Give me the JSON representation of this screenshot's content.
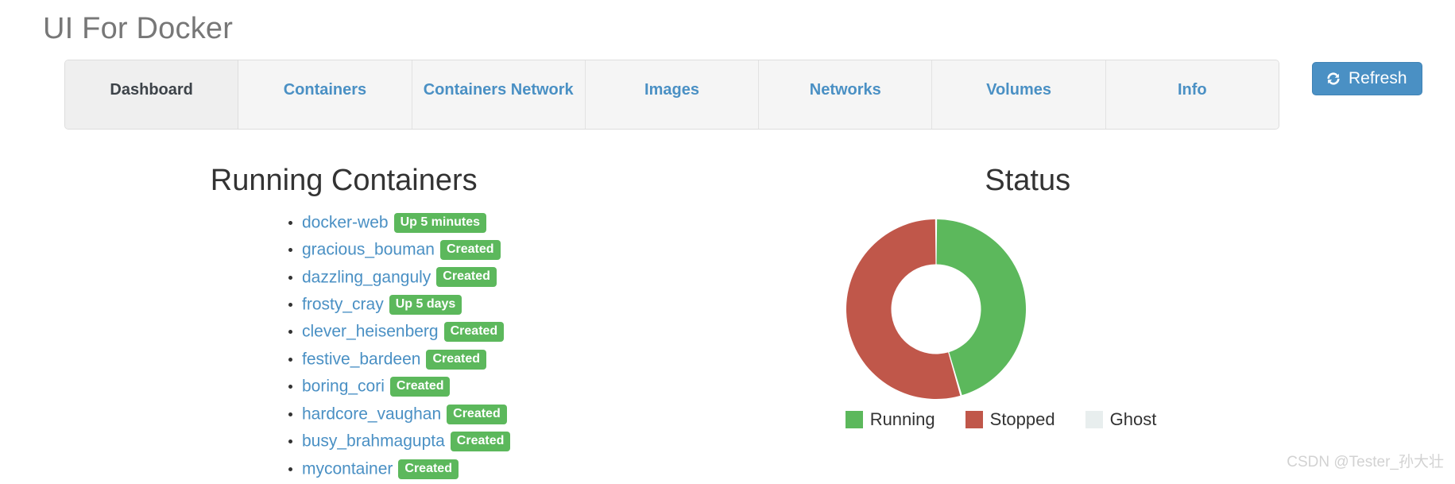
{
  "app": {
    "title": "UI For Docker",
    "watermark": "CSDN @Tester_孙大壮"
  },
  "tabs": {
    "items": [
      {
        "label": "Dashboard",
        "active": true
      },
      {
        "label": "Containers",
        "active": false
      },
      {
        "label": "Containers Network",
        "active": false
      },
      {
        "label": "Images",
        "active": false
      },
      {
        "label": "Networks",
        "active": false
      },
      {
        "label": "Volumes",
        "active": false
      },
      {
        "label": "Info",
        "active": false
      }
    ]
  },
  "toolbar": {
    "refresh_label": "Refresh",
    "refresh_icon": "refresh-icon"
  },
  "running_containers": {
    "title": "Running Containers",
    "items": [
      {
        "name": "docker-web",
        "status": "Up 5 minutes"
      },
      {
        "name": "gracious_bouman",
        "status": "Created"
      },
      {
        "name": "dazzling_ganguly",
        "status": "Created"
      },
      {
        "name": "frosty_cray",
        "status": "Up 5 days"
      },
      {
        "name": "clever_heisenberg",
        "status": "Created"
      },
      {
        "name": "festive_bardeen",
        "status": "Created"
      },
      {
        "name": "boring_cori",
        "status": "Created"
      },
      {
        "name": "hardcore_vaughan",
        "status": "Created"
      },
      {
        "name": "busy_brahmagupta",
        "status": "Created"
      },
      {
        "name": "mycontainer",
        "status": "Created"
      }
    ]
  },
  "status_panel": {
    "title": "Status"
  },
  "chart_data": {
    "type": "pie",
    "variant": "donut",
    "title": "Status",
    "categories": [
      "Running",
      "Stopped",
      "Ghost"
    ],
    "values": [
      45.5,
      54.5,
      0
    ],
    "colors": [
      "#5cb85c",
      "#c0574a",
      "#e8eeee"
    ],
    "legend_position": "bottom",
    "start_angle": 0,
    "direction": "clockwise",
    "inner_radius_ratio": 0.5
  },
  "colors": {
    "accent": "#4a90c4",
    "badge_green": "#5cb85c",
    "chart_green": "#5cb85c",
    "chart_red": "#c0574a",
    "chart_ghost": "#e8eeee",
    "tab_bar_bg": "#f5f5f5",
    "title_gray": "#777777"
  }
}
